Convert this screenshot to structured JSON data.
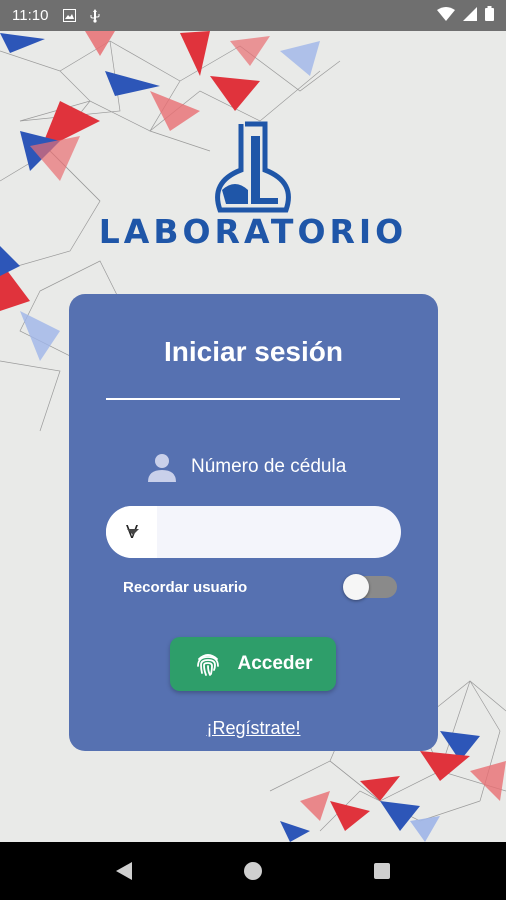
{
  "status_bar": {
    "time": "11:10",
    "left_icons": [
      "image-notification-icon",
      "usb-notification-icon"
    ],
    "right_icons": [
      "wifi-icon",
      "signal-icon",
      "battery-icon"
    ]
  },
  "logo": {
    "text": "LABORATORIO",
    "brand_color": "#1f56a8"
  },
  "login_card": {
    "title": "Iniciar sesión",
    "id_label": "Número de cédula",
    "id_type_selected": "V",
    "id_value": "",
    "remember_label": "Recordar usuario",
    "remember_on": false,
    "login_button": "Acceder",
    "register_link": "¡Regístrate!",
    "card_color": "#5671b1",
    "button_color": "#2e9e6a"
  },
  "nav_bar": {
    "buttons": [
      "back-icon",
      "home-icon",
      "recents-icon"
    ]
  }
}
